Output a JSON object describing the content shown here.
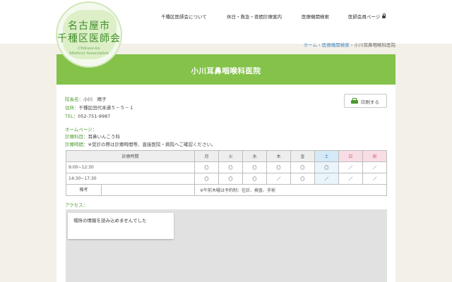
{
  "logo": {
    "line1": "名古屋市",
    "line2": "千種区医師会",
    "en1": "Chikusa-ku",
    "en2": "Medical Association"
  },
  "nav": {
    "items": [
      {
        "label": "千種区医師会について"
      },
      {
        "label": "休日・救急・夜間診療案内"
      },
      {
        "label": "医療機関検索"
      },
      {
        "label": "医師会員ページ"
      }
    ]
  },
  "breadcrumb": {
    "home": "ホーム",
    "search": "医療機関検索",
    "sep": "›",
    "current": "小川耳鼻咽喉科医院"
  },
  "page": {
    "title": "小川耳鼻咽喉科医院"
  },
  "clinic": {
    "director_label": "院長名：",
    "director": "小川　晴子",
    "address_label": "住所：",
    "address": "千種区田代本通５－５－１",
    "tel_label": "TEL：",
    "tel": "052-751-9987",
    "homepage_label": "ホームページ：",
    "department_label": "診療科目：",
    "department": "耳鼻いんこう科",
    "hours_label": "診療時間：",
    "hours_note": "※受診の際は診療時間等、直接医院・病院へご確認ください。",
    "print_label": "印刷する"
  },
  "schedule": {
    "header_time": "診療時間",
    "days": [
      "月",
      "火",
      "水",
      "木",
      "金",
      "土",
      "日",
      "祝"
    ],
    "rows": [
      {
        "time": "9:00~12:30",
        "marks": [
          "〇",
          "〇",
          "〇",
          "〇",
          "〇",
          "〇",
          "／",
          "／"
        ]
      },
      {
        "time": "14:30~17:30",
        "marks": [
          "〇",
          "〇",
          "〇",
          "／",
          "〇",
          "／",
          "／",
          "／"
        ]
      }
    ],
    "remarks_label": "備考",
    "remarks": "※午前木曜は予約制：往診、検査、手術"
  },
  "access": {
    "label": "アクセス：",
    "map_error": "場所の情報を読み込めませんでした"
  },
  "colors": {
    "brand_green": "#84c24a",
    "label_green": "#4b9a2c",
    "saturday_blue": "#d5e9f6",
    "sunday_pink": "#f8dde4"
  }
}
